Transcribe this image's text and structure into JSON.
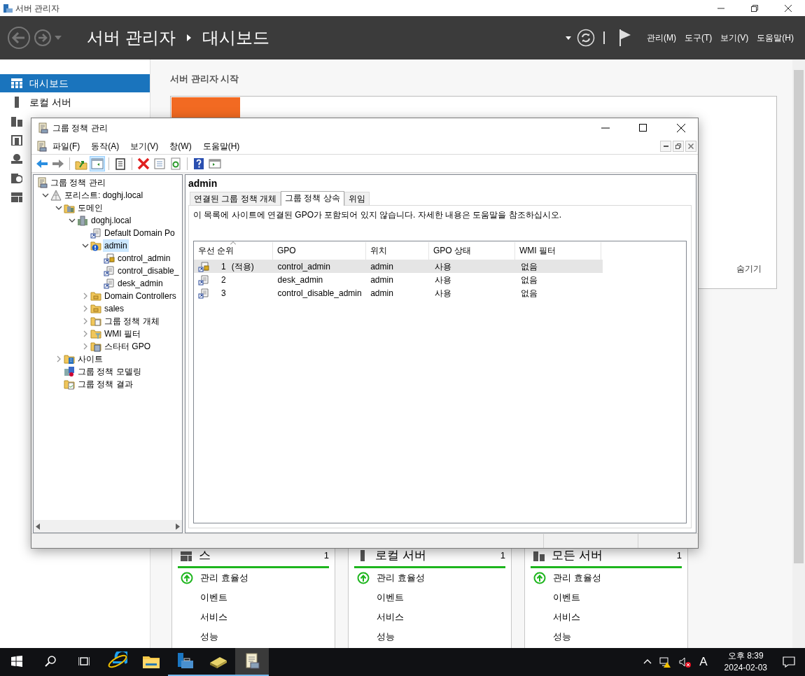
{
  "app_window": {
    "title": "서버 관리자"
  },
  "header": {
    "breadcrumb": [
      "서버 관리자",
      "대시보드"
    ],
    "menus": [
      "관리(M)",
      "도구(T)",
      "보기(V)",
      "도움말(H)"
    ]
  },
  "sidebar": {
    "items": [
      {
        "kind": "dashboard",
        "label": "대시보드",
        "selected": true
      },
      {
        "kind": "local",
        "label": "로컬 서버",
        "selected": false
      },
      {
        "kind": "all",
        "selected": false
      },
      {
        "kind": "adds",
        "selected": false
      },
      {
        "kind": "dns",
        "selected": false
      },
      {
        "kind": "iis",
        "selected": false
      },
      {
        "kind": "files",
        "selected": false
      }
    ]
  },
  "main": {
    "title": "서버 관리자 시작",
    "hide_link": "숨기기",
    "tiles": [
      {
        "kind": "files",
        "title": "스",
        "count": "1",
        "rows": [
          {
            "label": "관리 효율성",
            "healthy": true
          },
          {
            "label": "이벤트",
            "healthy": false
          },
          {
            "label": "서비스",
            "healthy": false
          },
          {
            "label": "성능",
            "healthy": false
          }
        ]
      },
      {
        "kind": "local",
        "title": "로컬 서버",
        "count": "1",
        "rows": [
          {
            "label": "관리 효율성",
            "healthy": true
          },
          {
            "label": "이벤트",
            "healthy": false
          },
          {
            "label": "서비스",
            "healthy": false
          },
          {
            "label": "성능",
            "healthy": false
          }
        ]
      },
      {
        "kind": "all",
        "title": "모든 서버",
        "count": "1",
        "rows": [
          {
            "label": "관리 효율성",
            "healthy": true
          },
          {
            "label": "이벤트",
            "healthy": false
          },
          {
            "label": "서비스",
            "healthy": false
          },
          {
            "label": "성능",
            "healthy": false
          }
        ]
      }
    ]
  },
  "gpmc_window": {
    "title": "그룹 정책 관리",
    "menus": [
      "파일(F)",
      "동작(A)",
      "보기(V)",
      "창(W)",
      "도움말(H)"
    ],
    "toolbar": [
      {
        "kind": "back"
      },
      {
        "kind": "forward"
      },
      {
        "kind": "sep"
      },
      {
        "kind": "up"
      },
      {
        "kind": "tree",
        "pressed": true
      },
      {
        "kind": "sep"
      },
      {
        "kind": "clipboard"
      },
      {
        "kind": "sep"
      },
      {
        "kind": "delete"
      },
      {
        "kind": "properties"
      },
      {
        "kind": "refresh"
      },
      {
        "kind": "sep"
      },
      {
        "kind": "help"
      },
      {
        "kind": "console"
      }
    ],
    "tree": [
      {
        "kind": "gpmc",
        "label": "그룹 정책 관리",
        "selected": false,
        "children": [
          {
            "kind": "forest",
            "label": "포리스트: doghj.local",
            "expanded": true,
            "selected": false,
            "children": [
              {
                "kind": "domains",
                "label": "도메인",
                "expanded": true,
                "selected": false,
                "children": [
                  {
                    "kind": "domain",
                    "label": "doghj.local",
                    "expanded": true,
                    "selected": false,
                    "children": [
                      {
                        "kind": "gpo-link",
                        "label": "Default Domain Po",
                        "selected": false
                      },
                      {
                        "kind": "ou-blocked",
                        "label": "admin",
                        "expanded": true,
                        "selected": true,
                        "children": [
                          {
                            "kind": "gpo-enforced",
                            "label": "control_admin",
                            "selected": false
                          },
                          {
                            "kind": "gpo-link",
                            "label": "control_disable_",
                            "selected": false
                          },
                          {
                            "kind": "gpo-link",
                            "label": "desk_admin",
                            "selected": false
                          }
                        ]
                      },
                      {
                        "kind": "ou",
                        "label": "Domain Controllers",
                        "expanded": false,
                        "selected": false
                      },
                      {
                        "kind": "ou",
                        "label": "sales",
                        "expanded": false,
                        "selected": false
                      },
                      {
                        "kind": "gpo-folder",
                        "label": "그룹 정책 개체",
                        "expanded": false,
                        "selected": false
                      },
                      {
                        "kind": "wmi",
                        "label": "WMI 필터",
                        "expanded": false,
                        "selected": false
                      },
                      {
                        "kind": "starter",
                        "label": "스타터 GPO",
                        "expanded": false,
                        "selected": false
                      }
                    ]
                  }
                ]
              },
              {
                "kind": "sites",
                "label": "사이트",
                "expanded": false,
                "selected": false
              },
              {
                "kind": "modeling",
                "label": "그룹 정책 모델링",
                "selected": false
              },
              {
                "kind": "results",
                "label": "그룹 정책 결과",
                "selected": false
              }
            ]
          }
        ]
      }
    ],
    "detail": {
      "heading": "admin",
      "tabs": [
        {
          "label": "연결된 그룹 정책 개체",
          "selected": false
        },
        {
          "label": "그룹 정책 상속",
          "selected": true
        },
        {
          "label": "위임",
          "selected": false
        }
      ],
      "message": "이 목록에 사이트에 연결된 GPO가 포함되어 있지 않습니다. 자세한 내용은 도움말을 참조하십시오.",
      "table": {
        "columns": [
          "우선 순위",
          "GPO",
          "위치",
          "GPO 상태",
          "WMI 필터"
        ],
        "rows": [
          {
            "kind": "enforced",
            "priority": "1",
            "note": "(적용)",
            "gpo": "control_admin",
            "location": "admin",
            "status": "사용",
            "wmi": "없음",
            "selected": true
          },
          {
            "kind": "normal",
            "priority": "2",
            "gpo": "desk_admin",
            "location": "admin",
            "status": "사용",
            "wmi": "없음",
            "selected": false
          },
          {
            "kind": "normal",
            "priority": "3",
            "gpo": "control_disable_admin",
            "location": "admin",
            "status": "사용",
            "wmi": "없음",
            "selected": false
          }
        ]
      }
    }
  },
  "taskbar": {
    "apps": [
      {
        "kind": "ie",
        "running": false,
        "active": false
      },
      {
        "kind": "explorer",
        "running": false,
        "active": false
      },
      {
        "kind": "server-manager",
        "running": true,
        "active": false
      },
      {
        "kind": "book",
        "running": true,
        "active": false
      },
      {
        "kind": "gpmc",
        "running": true,
        "active": true
      }
    ],
    "ime": "A",
    "time": "오후 8:39",
    "date": "2024-02-03"
  }
}
